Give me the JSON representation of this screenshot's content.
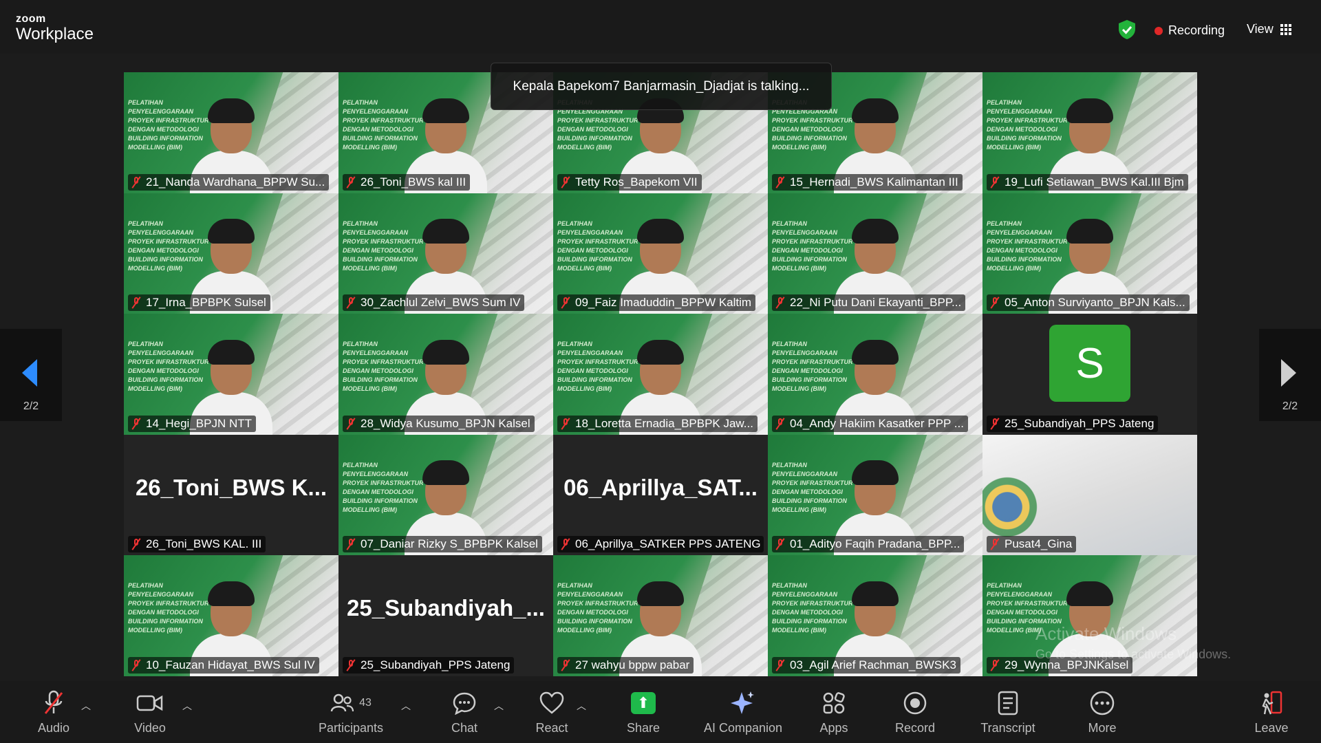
{
  "app": {
    "logo_small": "zoom",
    "logo_big": "Workplace"
  },
  "header": {
    "recording_label": "Recording",
    "view_label": "View"
  },
  "talking": "Kepala Bapekom7 Banjarmasin_Djadjat is talking...",
  "nav": {
    "left_page": "2/2",
    "right_page": "2/2"
  },
  "tiles": [
    {
      "name": "21_Nanda Wardhana_BPPW Su...",
      "kind": "video"
    },
    {
      "name": "26_Toni_BWS kal III",
      "kind": "video"
    },
    {
      "name": "Tetty Ros_Bapekom VII",
      "kind": "video"
    },
    {
      "name": "15_Hernadi_BWS Kalimantan III",
      "kind": "video"
    },
    {
      "name": "19_Lufi Setiawan_BWS Kal.III Bjm",
      "kind": "video"
    },
    {
      "name": "17_Irna_BPBPK Sulsel",
      "kind": "video"
    },
    {
      "name": "30_Zachlul Zelvi_BWS Sum IV",
      "kind": "video"
    },
    {
      "name": "09_Faiz Imaduddin_BPPW Kaltim",
      "kind": "video"
    },
    {
      "name": "22_Ni Putu Dani Ekayanti_BPP...",
      "kind": "video"
    },
    {
      "name": "05_Anton Surviyanto_BPJN Kals...",
      "kind": "video"
    },
    {
      "name": "14_Hegi_BPJN NTT",
      "kind": "video"
    },
    {
      "name": "28_Widya Kusumo_BPJN Kalsel",
      "kind": "video"
    },
    {
      "name": "18_Loretta Ernadia_BPBPK Jaw...",
      "kind": "video"
    },
    {
      "name": "04_Andy Hakiim Kasatker PPP ...",
      "kind": "video"
    },
    {
      "name": "25_Subandiyah_PPS Jateng",
      "kind": "avatar",
      "avatar_letter": "S"
    },
    {
      "name": "26_Toni_BWS KAL. III",
      "kind": "name",
      "display": "26_Toni_BWS K..."
    },
    {
      "name": "07_Daniar Rizky S_BPBPK Kalsel",
      "kind": "video"
    },
    {
      "name": "06_Aprillya_SATKER PPS JATENG",
      "kind": "name",
      "display": "06_Aprillya_SAT..."
    },
    {
      "name": "01_Adityo Faqih Pradana_BPP...",
      "kind": "video"
    },
    {
      "name": "Pusat4_Gina",
      "kind": "slide"
    },
    {
      "name": "10_Fauzan Hidayat_BWS Sul IV",
      "kind": "video"
    },
    {
      "name": "25_Subandiyah_PPS Jateng",
      "kind": "name",
      "display": "25_Subandiyah_..."
    },
    {
      "name": "27 wahyu bppw pabar",
      "kind": "video"
    },
    {
      "name": "03_Agil Arief Rachman_BWSK3",
      "kind": "video"
    },
    {
      "name": "29_Wynna_BPJNKalsel",
      "kind": "video"
    }
  ],
  "slide_banner_lines": [
    "PELATIHAN",
    "PENYELENGGARAAN",
    "PROYEK INFRASTRUKTUR",
    "DENGAN METODOLOGI",
    "BUILDING INFORMATION",
    "MODELLING (BIM)"
  ],
  "watermark": {
    "line1": "Activate Windows",
    "line2": "Go to Settings to activate Windows."
  },
  "toolbar": {
    "audio": "Audio",
    "video": "Video",
    "participants": "Participants",
    "participants_count": "43",
    "chat": "Chat",
    "react": "React",
    "share": "Share",
    "ai_companion": "AI Companion",
    "apps": "Apps",
    "record": "Record",
    "transcript": "Transcript",
    "more": "More",
    "leave": "Leave"
  }
}
